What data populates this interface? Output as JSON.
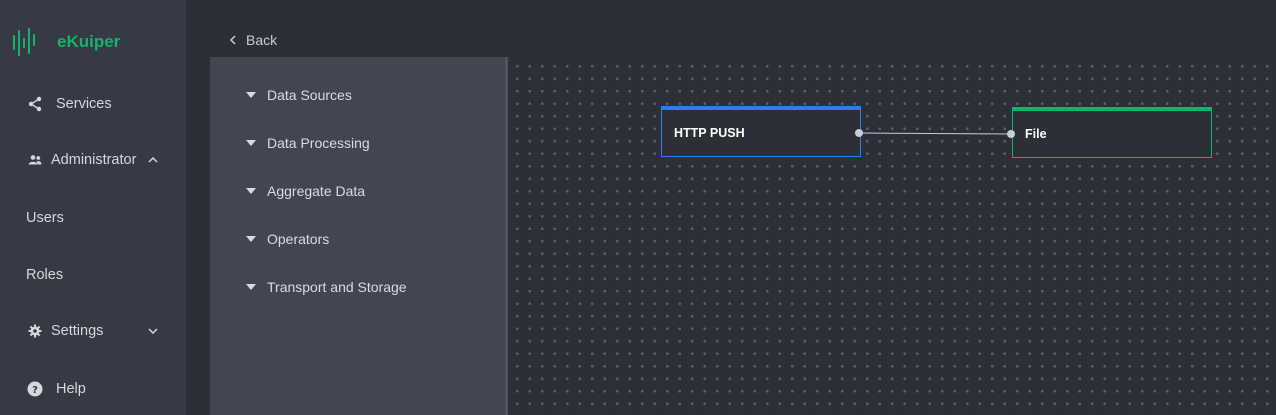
{
  "app": {
    "name": "eKuiper",
    "brand_color": "#17b26a"
  },
  "sidebar": {
    "items": [
      {
        "label": "Services",
        "icon": "share-icon"
      },
      {
        "label": "Administrator",
        "icon": "people-icon",
        "expanded": true
      },
      {
        "label": "Users"
      },
      {
        "label": "Roles"
      },
      {
        "label": "Settings",
        "icon": "gear-icon",
        "expanded": false
      },
      {
        "label": "Help",
        "icon": "help-icon"
      }
    ]
  },
  "header": {
    "back_label": "Back"
  },
  "palette": {
    "categories": [
      {
        "label": "Data Sources"
      },
      {
        "label": "Data Processing"
      },
      {
        "label": "Aggregate Data"
      },
      {
        "label": "Operators"
      },
      {
        "label": "Transport and Storage"
      }
    ]
  },
  "flow": {
    "nodes": [
      {
        "label": "HTTP PUSH",
        "kind": "source",
        "color": "#2f7cf0"
      },
      {
        "label": "File",
        "kind": "sink",
        "color": "#17b26a"
      }
    ]
  }
}
